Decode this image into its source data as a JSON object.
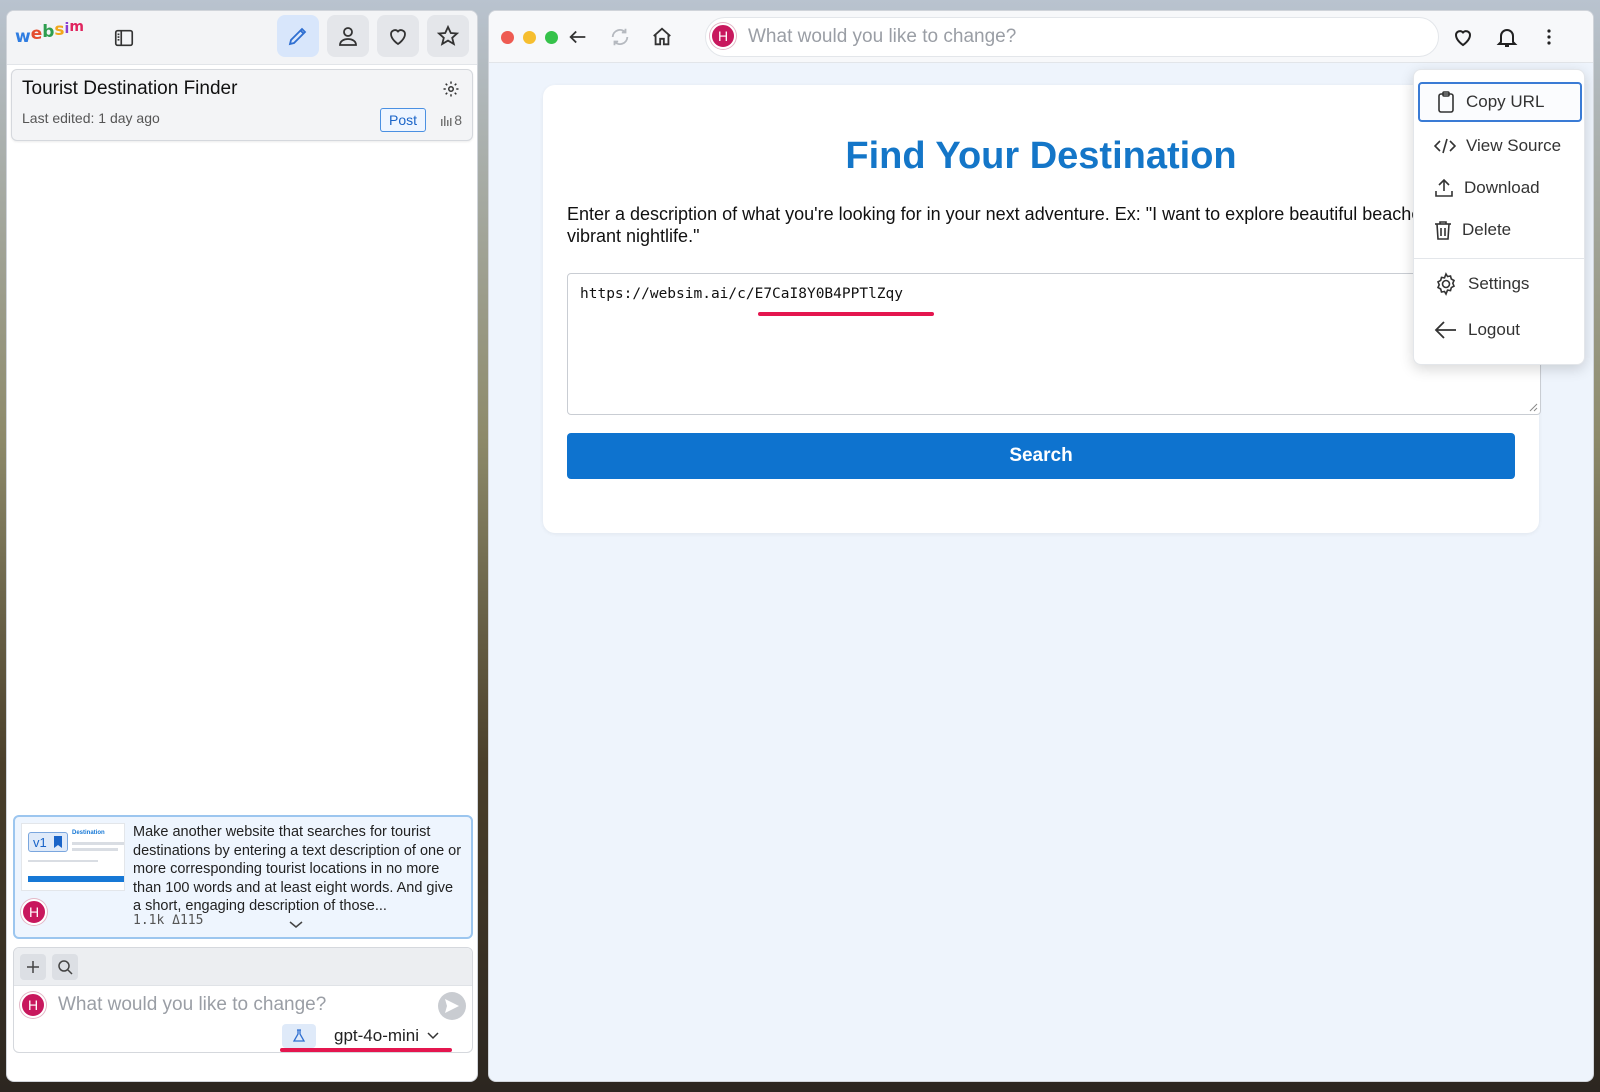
{
  "left": {
    "logo": [
      "w",
      "e",
      "b",
      "s",
      "i",
      "m"
    ],
    "logo_colors": [
      "#2f7de1",
      "#e44d2e",
      "#2e9e4f",
      "#f2a71b",
      "#8a3fd1",
      "#e0245e"
    ],
    "project": {
      "title": "Tourist Destination Finder",
      "last_edited": "Last edited: 1 day ago",
      "post_label": "Post",
      "views": "8"
    },
    "version": {
      "badge": "v1",
      "thumb_title": "Destination",
      "prompt": "Make another website that searches for tourist destinations by entering a text description of one or more corresponding tourist locations in no more than 100 words and at least eight words. And give a short, engaging description of those...",
      "stats": "1.1k Δ115",
      "avatar_letter": "H"
    },
    "composer": {
      "avatar_letter": "H",
      "placeholder": "What would you like to change?",
      "model": "gpt-4o-mini"
    }
  },
  "right": {
    "url_bar": {
      "avatar_letter": "H",
      "placeholder": "What would you like to change?"
    },
    "page": {
      "heading": "Find Your Destination",
      "description": "Enter a description of what you're looking for in your next adventure. Ex: \"I want to explore beautiful beaches and vibrant nightlife.\"",
      "textarea_value": "https://websim.ai/c/E7CaI8Y0B4PPTlZqy",
      "search_label": "Search"
    },
    "menu": {
      "copy_url": "Copy URL",
      "view_source": "View Source",
      "download": "Download",
      "delete": "Delete",
      "settings": "Settings",
      "logout": "Logout"
    }
  },
  "colors": {
    "accent": "#1476c8",
    "avatar": "#c8175d",
    "annotation": "#e4164f"
  }
}
